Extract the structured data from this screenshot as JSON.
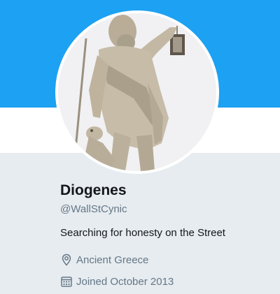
{
  "colors": {
    "banner": "#1da1f2",
    "card_background": "#e6ecf0",
    "name": "#14171a",
    "secondary_text": "#657786"
  },
  "profile": {
    "name": "Diogenes",
    "handle": "@WallStCynic",
    "bio": "Searching for honesty on the Street",
    "location": "Ancient Greece",
    "joined": "Joined October 2013",
    "location_icon": "location-pin-icon",
    "calendar_icon": "calendar-icon"
  }
}
